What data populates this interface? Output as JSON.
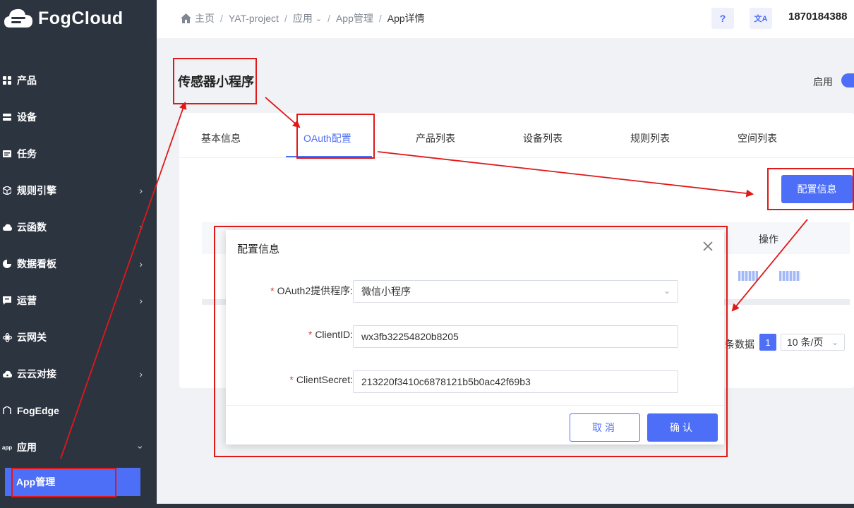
{
  "app": {
    "logo_text": "FogCloud",
    "user_name": "1870184388"
  },
  "colors": {
    "accent": "#4d6ef6",
    "sidebar_bg": "#2c3440",
    "required_star": "#e23b3b",
    "annotation": "#e01818"
  },
  "breadcrumb": {
    "items": [
      "主页",
      "YAT-project",
      "应用",
      "App管理"
    ],
    "current": "App详情",
    "dropdown_icon": "chevron-down-icon"
  },
  "header": {
    "help_label": "?",
    "translate_label": "文A"
  },
  "sidebar": {
    "items": [
      {
        "label": "产品",
        "icon": "grid-icon",
        "has_arrow": false
      },
      {
        "label": "设备",
        "icon": "device-icon",
        "has_arrow": false
      },
      {
        "label": "任务",
        "icon": "task-icon",
        "has_arrow": false
      },
      {
        "label": "规则引擎",
        "icon": "cube-icon",
        "has_arrow": true
      },
      {
        "label": "云函数",
        "icon": "cloud-icon",
        "has_arrow": true
      },
      {
        "label": "数据看板",
        "icon": "pie-icon",
        "has_arrow": true
      },
      {
        "label": "运营",
        "icon": "chat-icon",
        "has_arrow": true
      },
      {
        "label": "云网关",
        "icon": "gateway-icon",
        "has_arrow": false
      },
      {
        "label": "云云对接",
        "icon": "cloud-link-icon",
        "has_arrow": true
      },
      {
        "label": "FogEdge",
        "icon": "edge-icon",
        "has_arrow": false
      },
      {
        "label": "应用",
        "icon": "app-icon",
        "has_arrow": true
      }
    ],
    "app_icon_text": "app",
    "active_sub_item": "App管理"
  },
  "page": {
    "title": "传感器小程序",
    "status_label": "启用"
  },
  "tabs": [
    {
      "label": "基本信息",
      "active": false
    },
    {
      "label": "OAuth配置",
      "active": true
    },
    {
      "label": "产品列表",
      "active": false
    },
    {
      "label": "设备列表",
      "active": false
    },
    {
      "label": "规则列表",
      "active": false
    },
    {
      "label": "空间列表",
      "active": false
    }
  ],
  "content": {
    "config_button": "配置信息",
    "table_header_op": "操作",
    "pagination": {
      "text": "条数据",
      "current_page": "1",
      "page_size": "10 条/页"
    }
  },
  "dialog": {
    "title": "配置信息",
    "fields": [
      {
        "label": "OAuth2提供程序:",
        "value": "微信小程序",
        "type": "select"
      },
      {
        "label": "ClientID:",
        "value": "wx3fb32254820b8205",
        "type": "text"
      },
      {
        "label": "ClientSecret:",
        "value": "213220f3410c6878121b5b0ac42f69b3",
        "type": "text"
      }
    ],
    "required_mark": "*",
    "cancel_label": "取消",
    "ok_label": "确认"
  }
}
